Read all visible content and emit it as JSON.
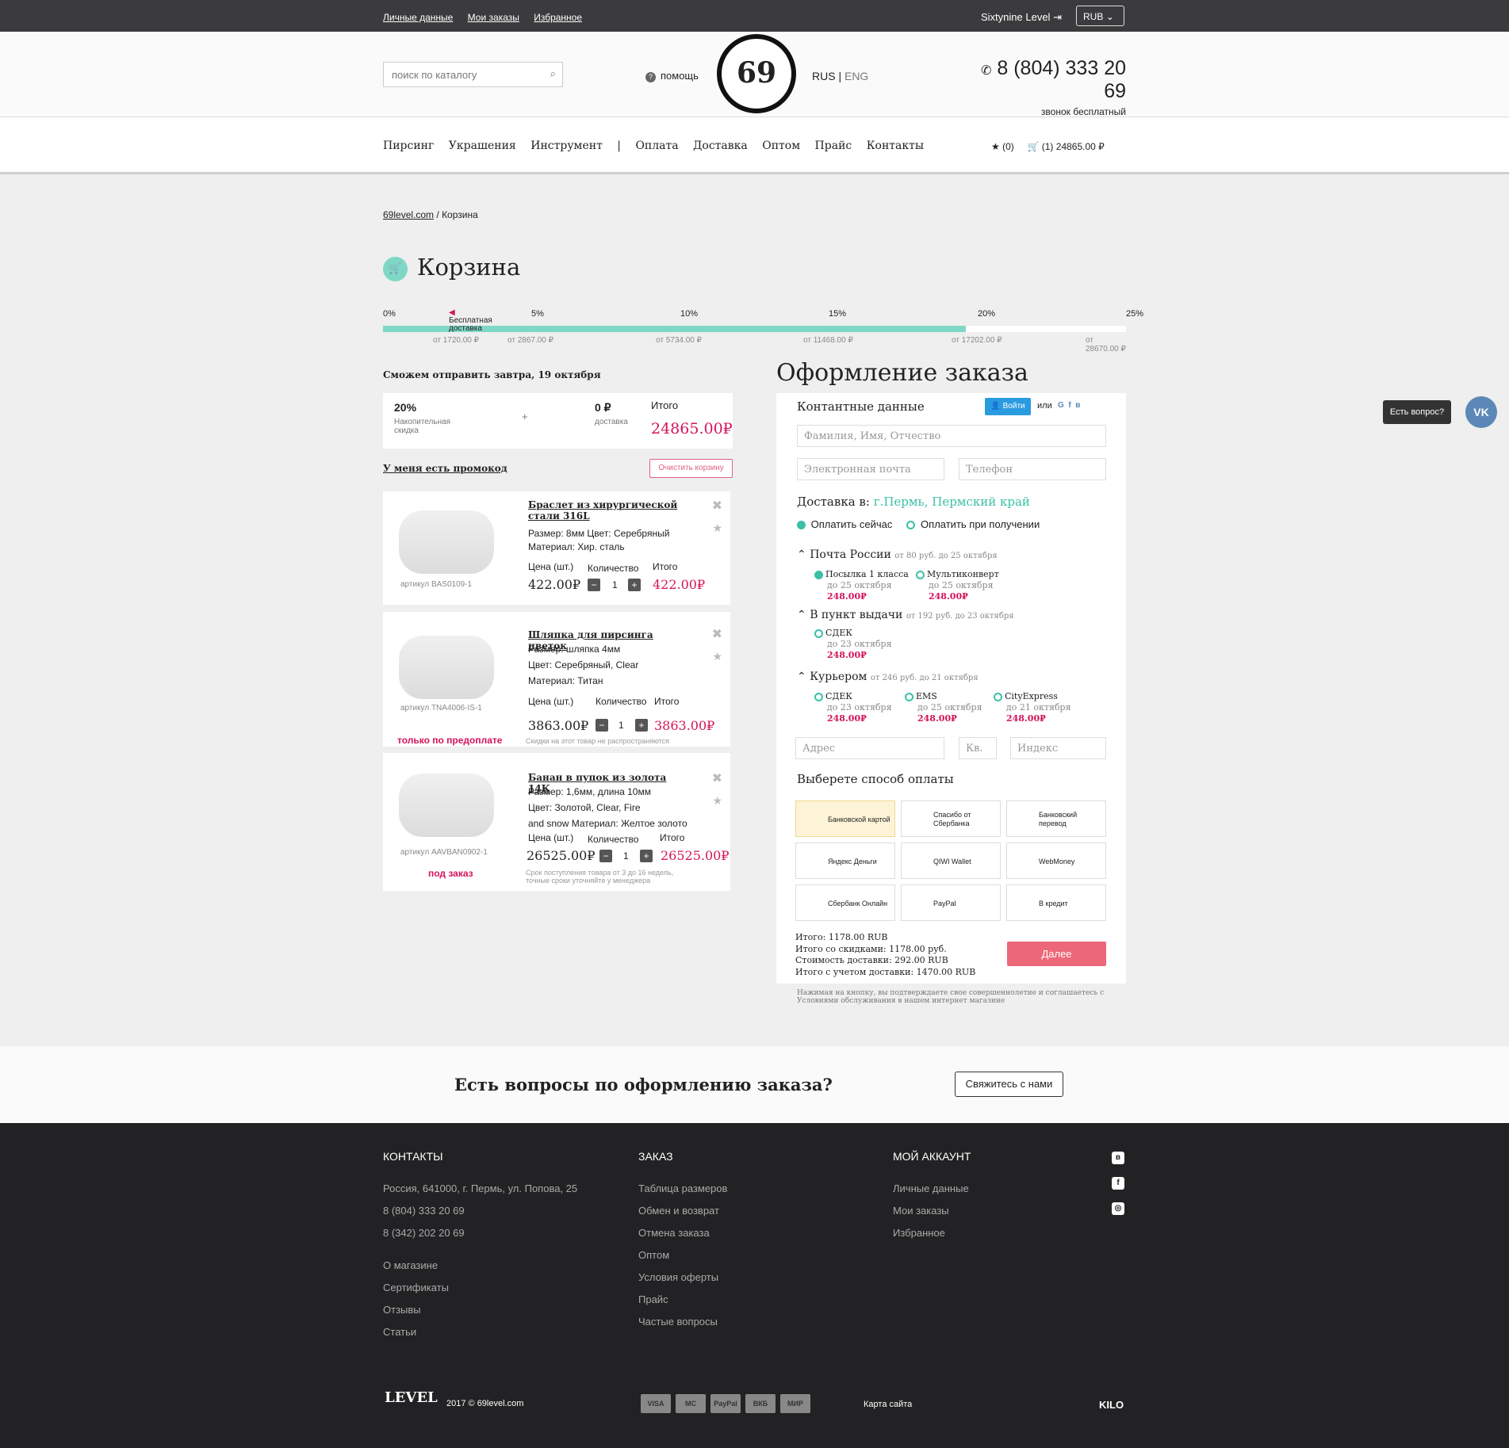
{
  "topbar": {
    "links": [
      "Личные данные",
      "Мои заказы",
      "Избранное"
    ],
    "user": "Sixtynine Level",
    "currency": "RUB"
  },
  "header": {
    "search_placeholder": "поиск по каталогу",
    "help": "помощь",
    "logo": "69",
    "lang_rus": "RUS",
    "lang_eng": "ENG",
    "phone": "8 (804) 333 20 69",
    "phone_note": "звонок бесплатный"
  },
  "nav": {
    "items": [
      "Пирсинг",
      "Украшения",
      "Инструмент",
      "|",
      "Оплата",
      "Доставка",
      "Оптом",
      "Прайс",
      "Контакты"
    ],
    "fav_count": "(0)",
    "cart_count": "(1)",
    "cart_total": "24865.00 ₽"
  },
  "breadcrumb": {
    "home": "69level.com",
    "sep": "/",
    "current": "Корзина"
  },
  "page_title": "Корзина",
  "progress": {
    "fill_fraction": 0.784,
    "labels": [
      "0%",
      "5%",
      "10%",
      "15%",
      "20%",
      "25%"
    ],
    "free_shipping": "Бесплатная доставка",
    "from": [
      "от 1720.00 ₽",
      "от 2867.00 ₽",
      "от 5734.00 ₽",
      "от 11468.00 ₽",
      "от 17202.00 ₽",
      "от 28670.00 ₽"
    ]
  },
  "cart": {
    "ship_note": "Сможем отправить завтра, 19 октября",
    "discount": "20%",
    "discount_label": "Накопительная скидка",
    "plus": "+",
    "delivery": "0 ₽",
    "delivery_label": "доставка",
    "total_label": "Итого",
    "total": "24865.00₽",
    "promo": "У меня есть промокод",
    "clear": "Очистить корзину",
    "price_label": "Цена (шт.)",
    "qty_label": "Количество",
    "sum_label": "Итого",
    "items": [
      {
        "name": "Браслет из хирургической стали 316L",
        "line1": "Размер: 8мм  Цвет:  Серебряный",
        "line2": "Материал: Хир. сталь",
        "article": "артикул BAS0109-1",
        "price": "422.00₽",
        "qty": "1",
        "sum": "422.00₽"
      },
      {
        "name": "Шляпка для пирсинга цветок",
        "line1": "Размер: шляпка 4мм",
        "line2": "Цвет:  Серебряный,  Clear",
        "line3": "Материал: Титан",
        "article": "артикул TNA4006-IS-1",
        "price": "3863.00₽",
        "qty": "1",
        "sum": "3863.00₽",
        "tag": "только по предоплате",
        "note": "Скидки на этот товар не распространяются"
      },
      {
        "name": "Банан в пупок из золота 14К",
        "line1": "Размер: 1,6мм, длина 10мм",
        "line2": "Цвет:  Золотой,  Clear,  Fire",
        "line3": "and snow  Материал: Желтое золото",
        "article": "артикул AAVBAN0902-1",
        "price": "26525.00₽",
        "qty": "1",
        "sum": "26525.00₽",
        "tag": "под заказ",
        "note": "Срок поступления товара от 3 до 16 недель, точные сроки уточняйте у менеджера"
      }
    ]
  },
  "order": {
    "title": "Оформление заказа",
    "contacts": "Контантные данные",
    "login": "Войти",
    "or": "или",
    "name_ph": "Фамилия, Имя, Отчество",
    "email_ph": "Электронная почта",
    "phone_ph": "Телефон",
    "delivery_to": "Доставка в:",
    "city": "г.Пермь, Пермский край",
    "pay_now": "Оплатить сейчас",
    "pay_later": "Оплатить при получении",
    "methods": [
      {
        "name": "Почта России",
        "info": "от 80 руб. до 25 октября",
        "opts": [
          {
            "n": "Посылка 1 класса",
            "d": "до 25 октября",
            "p": "248.00₽"
          },
          {
            "n": "Мультиконверт",
            "d": "до 25 октября",
            "p": "248.00₽"
          }
        ]
      },
      {
        "name": "В пункт выдачи",
        "info": "от 192 руб. до 23 октября",
        "opts": [
          {
            "n": "СДЕК",
            "d": "до 23 октября",
            "p": "248.00₽"
          }
        ]
      },
      {
        "name": "Курьером",
        "info": "от 246 руб. до 21 октября",
        "opts": [
          {
            "n": "СДЕК",
            "d": "до 23 октября",
            "p": "248.00₽"
          },
          {
            "n": "EMS",
            "d": "до 25 октября",
            "p": "248.00₽"
          },
          {
            "n": "CityExpress",
            "d": "до 21 октября",
            "p": "248.00₽"
          }
        ]
      }
    ],
    "addr_ph": "Адрес",
    "apt_ph": "Кв.",
    "zip_ph": "Индекс",
    "pay_title": "Выберете способ оплаты",
    "pays": [
      "Банковской картой",
      "Спасибо от Сбербанка",
      "Банковский перевод",
      "Яндекс Деньги",
      "QIWI Wallet",
      "WebMoney",
      "Сбербанк Онлайн",
      "PayPal",
      "В кредит"
    ],
    "tot1": "Итого: 1178.00 RUB",
    "tot2": "Итого со скидками: 1178.00 руб.",
    "tot3": "Стоимость доставки: 292.00 RUB",
    "tot4": "Итого с учетом доставки: 1470.00 RUB",
    "next": "Далее",
    "terms": "Нажимая на кнопку, вы подтверждаете свое совершеннолетие и соглашаетесь с Условиями обслуживания в нашем интернет магазине"
  },
  "widget": {
    "ask": "Есть вопрос?",
    "vk": "VK"
  },
  "band": {
    "question": "Есть вопросы по оформлению заказа?",
    "button": "Свяжитесь с нами"
  },
  "footer": {
    "contacts_h": "Контакты",
    "contacts": [
      "Россия, 641000, г. Пермь, ул. Попова, 25",
      "8 (804) 333 20 69",
      "8 (342) 202 20 69"
    ],
    "about": [
      "О магазине",
      "Сертификаты",
      "Отзывы",
      "Статьи"
    ],
    "order_h": "Заказ",
    "order": [
      "Таблица размеров",
      "Обмен и возврат",
      "Отмена заказа",
      "Оптом",
      "Условия оферты",
      "Прайс",
      "Частые вопросы"
    ],
    "account_h": "Мой аккаунт",
    "account": [
      "Личные данные",
      "Мои заказы",
      "Избранное"
    ],
    "copyright": "2017 © 69level.com",
    "sitemap": "Карта сайта",
    "brand": "KILO",
    "cards": [
      "VISA",
      "MC",
      "PayPal",
      "ВКБ",
      "МИР"
    ]
  }
}
